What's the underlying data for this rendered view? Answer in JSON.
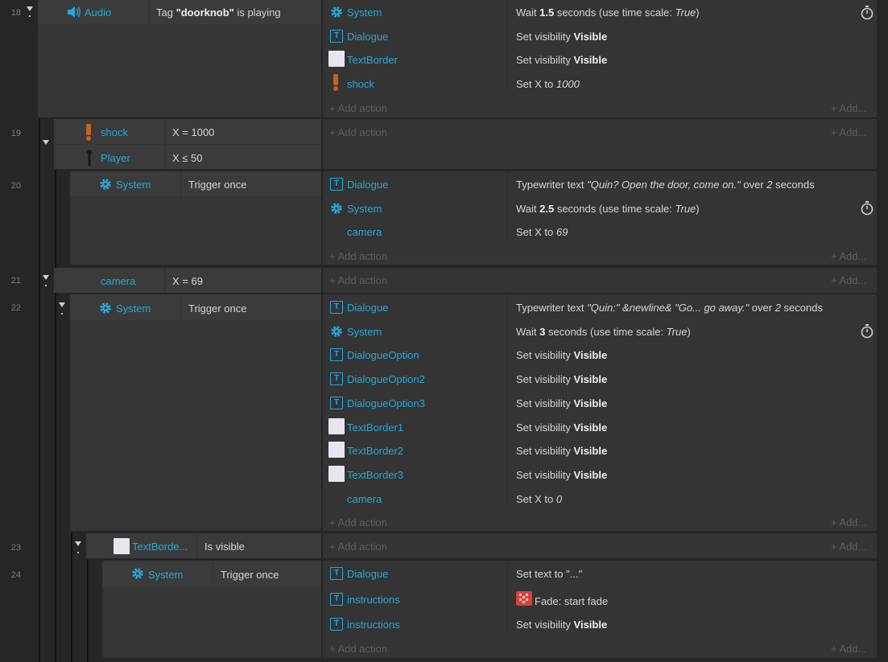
{
  "rows": {
    "r18": {
      "num": "18"
    },
    "r19": {
      "num": "19"
    },
    "r20": {
      "num": "20"
    },
    "r21": {
      "num": "21"
    },
    "r22": {
      "num": "22"
    },
    "r23": {
      "num": "23"
    },
    "r24": {
      "num": "24"
    }
  },
  "ev18": {
    "cond": {
      "object": "Audio",
      "text_pre": "Tag ",
      "text_bold": "\"doorknob\"",
      "text_post": " is playing"
    },
    "actions": [
      {
        "object": "System",
        "pre": "Wait ",
        "bold": "1.5",
        "post": " seconds (use time scale: ",
        "ital": "True",
        "end": ")"
      },
      {
        "object": "Dialogue",
        "text": "Set visibility ",
        "bold": "Visible"
      },
      {
        "object": "TextBorder",
        "text": "Set visibility ",
        "bold": "Visible"
      },
      {
        "object": "shock",
        "text": "Set X to ",
        "ital": "1000"
      }
    ]
  },
  "ev19": {
    "conds": [
      {
        "object": "shock",
        "text": "X = 1000"
      },
      {
        "object": "Player",
        "text": "X ≤ 50"
      }
    ]
  },
  "ev20": {
    "cond": {
      "object": "System",
      "text": "Trigger once"
    },
    "actions": [
      {
        "object": "Dialogue",
        "pre": "Typewriter text ",
        "ital": "\"Quin? Open the door, come on.\"",
        "mid": " over ",
        "ital2": "2",
        "post": " seconds"
      },
      {
        "object": "System",
        "pre": "Wait ",
        "bold": "2.5",
        "post": " seconds (use time scale: ",
        "ital": "True",
        "end": ")"
      },
      {
        "object": "camera",
        "text": "Set X to ",
        "ital": "69"
      }
    ]
  },
  "ev21": {
    "cond": {
      "object": "camera",
      "text": "X = 69"
    }
  },
  "ev22": {
    "cond": {
      "object": "System",
      "text": "Trigger once"
    },
    "actions": [
      {
        "object": "Dialogue",
        "pre": "Typewriter text ",
        "ital": "\"Quin:\" &newline& \"Go... go away.\"",
        "mid": " over ",
        "ital2": "2",
        "post": " seconds"
      },
      {
        "object": "System",
        "pre": "Wait ",
        "bold": "3",
        "post": " seconds (use time scale: ",
        "ital": "True",
        "end": ")"
      },
      {
        "object": "DialogueOption",
        "text": "Set visibility ",
        "bold": "Visible"
      },
      {
        "object": "DialogueOption2",
        "text": "Set visibility ",
        "bold": "Visible"
      },
      {
        "object": "DialogueOption3",
        "text": "Set visibility ",
        "bold": "Visible"
      },
      {
        "object": "TextBorder1",
        "text": "Set visibility ",
        "bold": "Visible"
      },
      {
        "object": "TextBorder2",
        "text": "Set visibility ",
        "bold": "Visible"
      },
      {
        "object": "TextBorder3",
        "text": "Set visibility ",
        "bold": "Visible"
      },
      {
        "object": "camera",
        "text": "Set X to ",
        "ital": "0"
      }
    ]
  },
  "ev23": {
    "cond": {
      "object": "TextBorde...",
      "text": "Is visible"
    }
  },
  "ev24": {
    "cond": {
      "object": "System",
      "text": "Trigger once"
    },
    "actions": [
      {
        "object": "Dialogue",
        "text": "Set text to \"...\""
      },
      {
        "object": "instructions",
        "text": "Fade: start fade"
      },
      {
        "object": "instructions",
        "text": "Set visibility ",
        "bold": "Visible"
      }
    ]
  },
  "labels": {
    "add_action": "Add action",
    "add_more": "Add..."
  }
}
